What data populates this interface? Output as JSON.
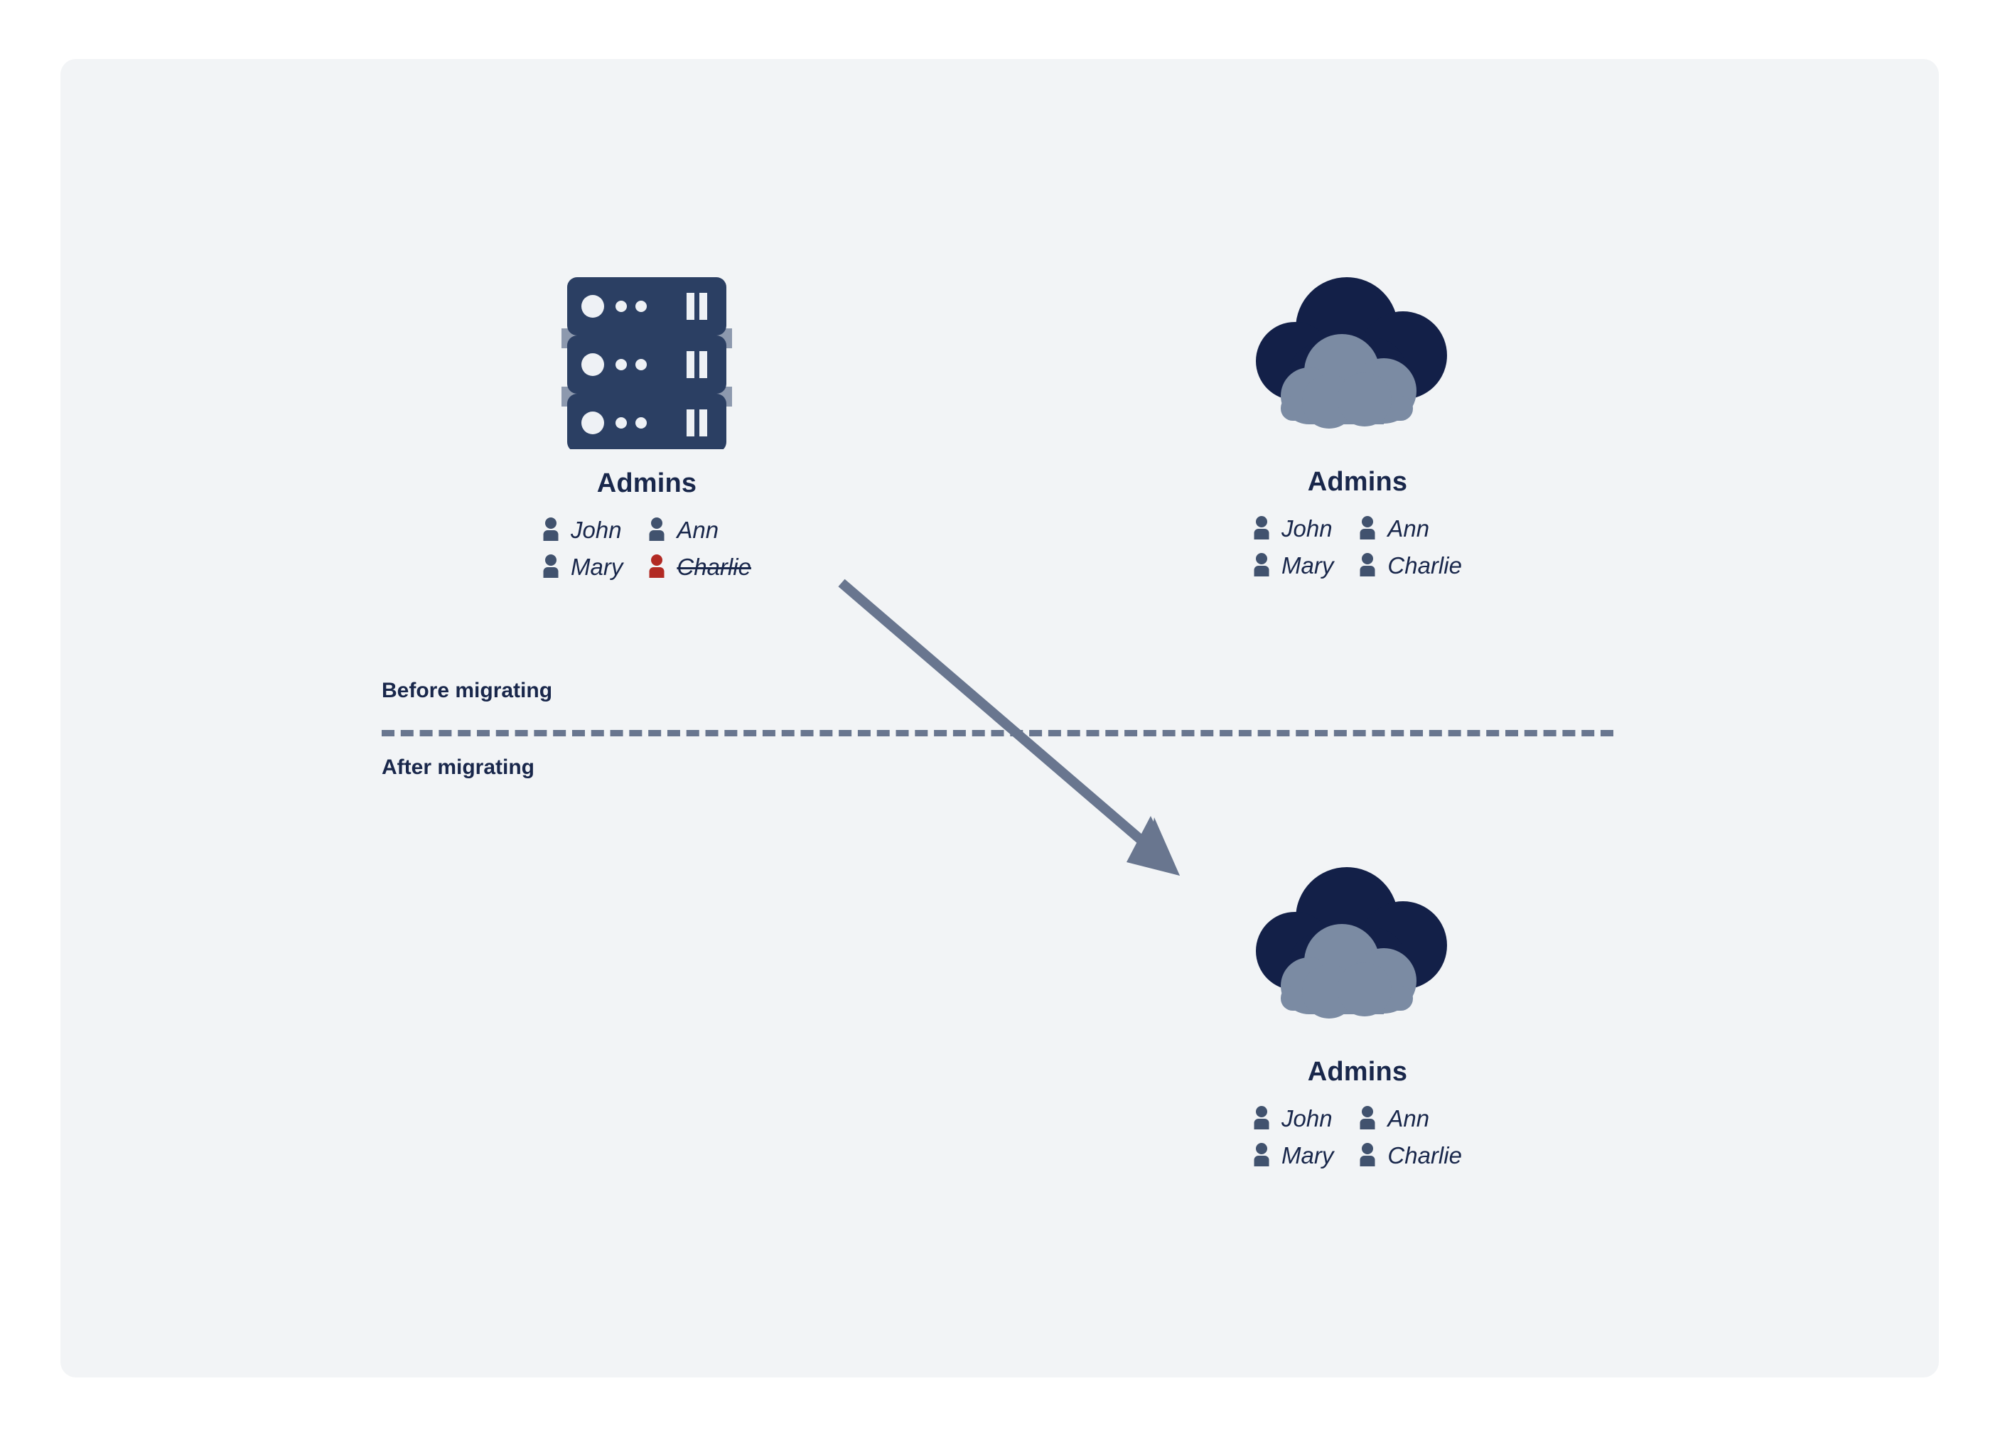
{
  "card": {
    "background_color": "#f2f4f6",
    "page_background_color": "#ffffff"
  },
  "palette": {
    "navy": "#132048",
    "title_navy": "#19274b",
    "slate": "#69768f",
    "person_slate": "#41526e",
    "cloud_gray": "#7b8ba3",
    "server_navy": "#2b3f63",
    "server_rail": "#8d99ae",
    "removed_red": "#b22a24"
  },
  "divider": {
    "before_label": "Before migrating",
    "after_label": "After migrating",
    "line_style": "dashed",
    "line_color": "#69768f"
  },
  "arrow": {
    "name": "migration-arrow",
    "color": "#69768f",
    "from": "source-server-group",
    "to": "target-cloud-group-after"
  },
  "nodes": [
    {
      "id": "source-server-group",
      "icon": "server-rack-icon",
      "title": "Admins",
      "section": "before-migrating",
      "members": [
        {
          "name": "John",
          "state": "present",
          "icon": "person-icon",
          "icon_color": "#41526e",
          "struck": false
        },
        {
          "name": "Ann",
          "state": "present",
          "icon": "person-icon",
          "icon_color": "#41526e",
          "struck": false
        },
        {
          "name": "Mary",
          "state": "present",
          "icon": "person-icon",
          "icon_color": "#41526e",
          "struck": false
        },
        {
          "name": "Charlie",
          "state": "removed",
          "icon": "person-removed-icon",
          "icon_color": "#b22a24",
          "struck": true
        }
      ]
    },
    {
      "id": "target-cloud-group-before",
      "icon": "cloud-icon",
      "title": "Admins",
      "section": "before-migrating",
      "members": [
        {
          "name": "John",
          "state": "present",
          "icon": "person-icon",
          "icon_color": "#41526e",
          "struck": false
        },
        {
          "name": "Ann",
          "state": "present",
          "icon": "person-icon",
          "icon_color": "#41526e",
          "struck": false
        },
        {
          "name": "Mary",
          "state": "present",
          "icon": "person-icon",
          "icon_color": "#41526e",
          "struck": false
        },
        {
          "name": "Charlie",
          "state": "present",
          "icon": "person-icon",
          "icon_color": "#41526e",
          "struck": false
        }
      ]
    },
    {
      "id": "target-cloud-group-after",
      "icon": "cloud-icon",
      "title": "Admins",
      "section": "after-migrating",
      "members": [
        {
          "name": "John",
          "state": "present",
          "icon": "person-icon",
          "icon_color": "#41526e",
          "struck": false
        },
        {
          "name": "Ann",
          "state": "present",
          "icon": "person-icon",
          "icon_color": "#41526e",
          "struck": false
        },
        {
          "name": "Mary",
          "state": "present",
          "icon": "person-icon",
          "icon_color": "#41526e",
          "struck": false
        },
        {
          "name": "Charlie",
          "state": "present",
          "icon": "person-icon",
          "icon_color": "#41526e",
          "struck": false
        }
      ]
    }
  ]
}
